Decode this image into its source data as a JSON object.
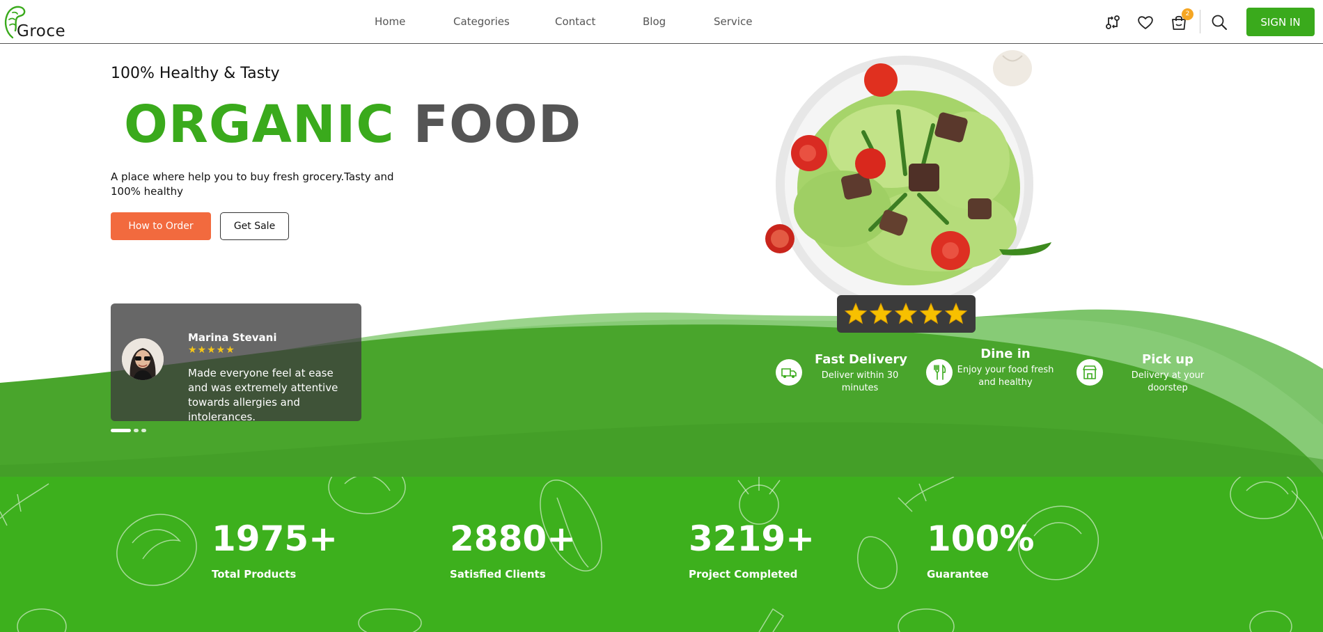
{
  "brand": {
    "logo_text": "Groce"
  },
  "nav": {
    "items": [
      {
        "label": "Home"
      },
      {
        "label": "Categories"
      },
      {
        "label": "Contact"
      },
      {
        "label": "Blog"
      },
      {
        "label": "Service"
      }
    ]
  },
  "header": {
    "cart_count": "2",
    "signin_label": "SIGN IN"
  },
  "hero": {
    "tagline": "100% Healthy & Tasty",
    "headline_green": "ORGANIC",
    "headline_dark": "FOOD",
    "description": "A place where help you to buy fresh grocery.Tasty and 100% healthy",
    "order_button": "How to Order",
    "sale_button": "Get Sale"
  },
  "testimonial": {
    "name": "Marina Stevani",
    "rating": 4.5,
    "stars_text": "★★★★★",
    "text": "Made everyone feel at ease and was extremely attentive towards allergies and intolerances.",
    "slide_count": 3,
    "active_slide": 1
  },
  "product_rating": {
    "stars": 5
  },
  "features": [
    {
      "title": "Fast Delivery",
      "text": "Deliver within 30 minutes",
      "icon": "delivery-truck-icon"
    },
    {
      "title": "Dine in",
      "text": "Enjoy your food fresh and healthy",
      "icon": "utensils-icon"
    },
    {
      "title": "Pick up",
      "text": "Delivery at your doorstep",
      "icon": "store-icon"
    }
  ],
  "stats": [
    {
      "value": "1975+",
      "label": "Total Products"
    },
    {
      "value": "2880+",
      "label": "Satisfied Clients"
    },
    {
      "value": "3219+",
      "label": "Project Completed"
    },
    {
      "value": "100%",
      "label": "Guarantee"
    }
  ],
  "colors": {
    "brand_green": "#3aaa1c",
    "accent_orange": "#f26a3e",
    "star_yellow": "#f5c518",
    "dark_text": "#555555"
  }
}
